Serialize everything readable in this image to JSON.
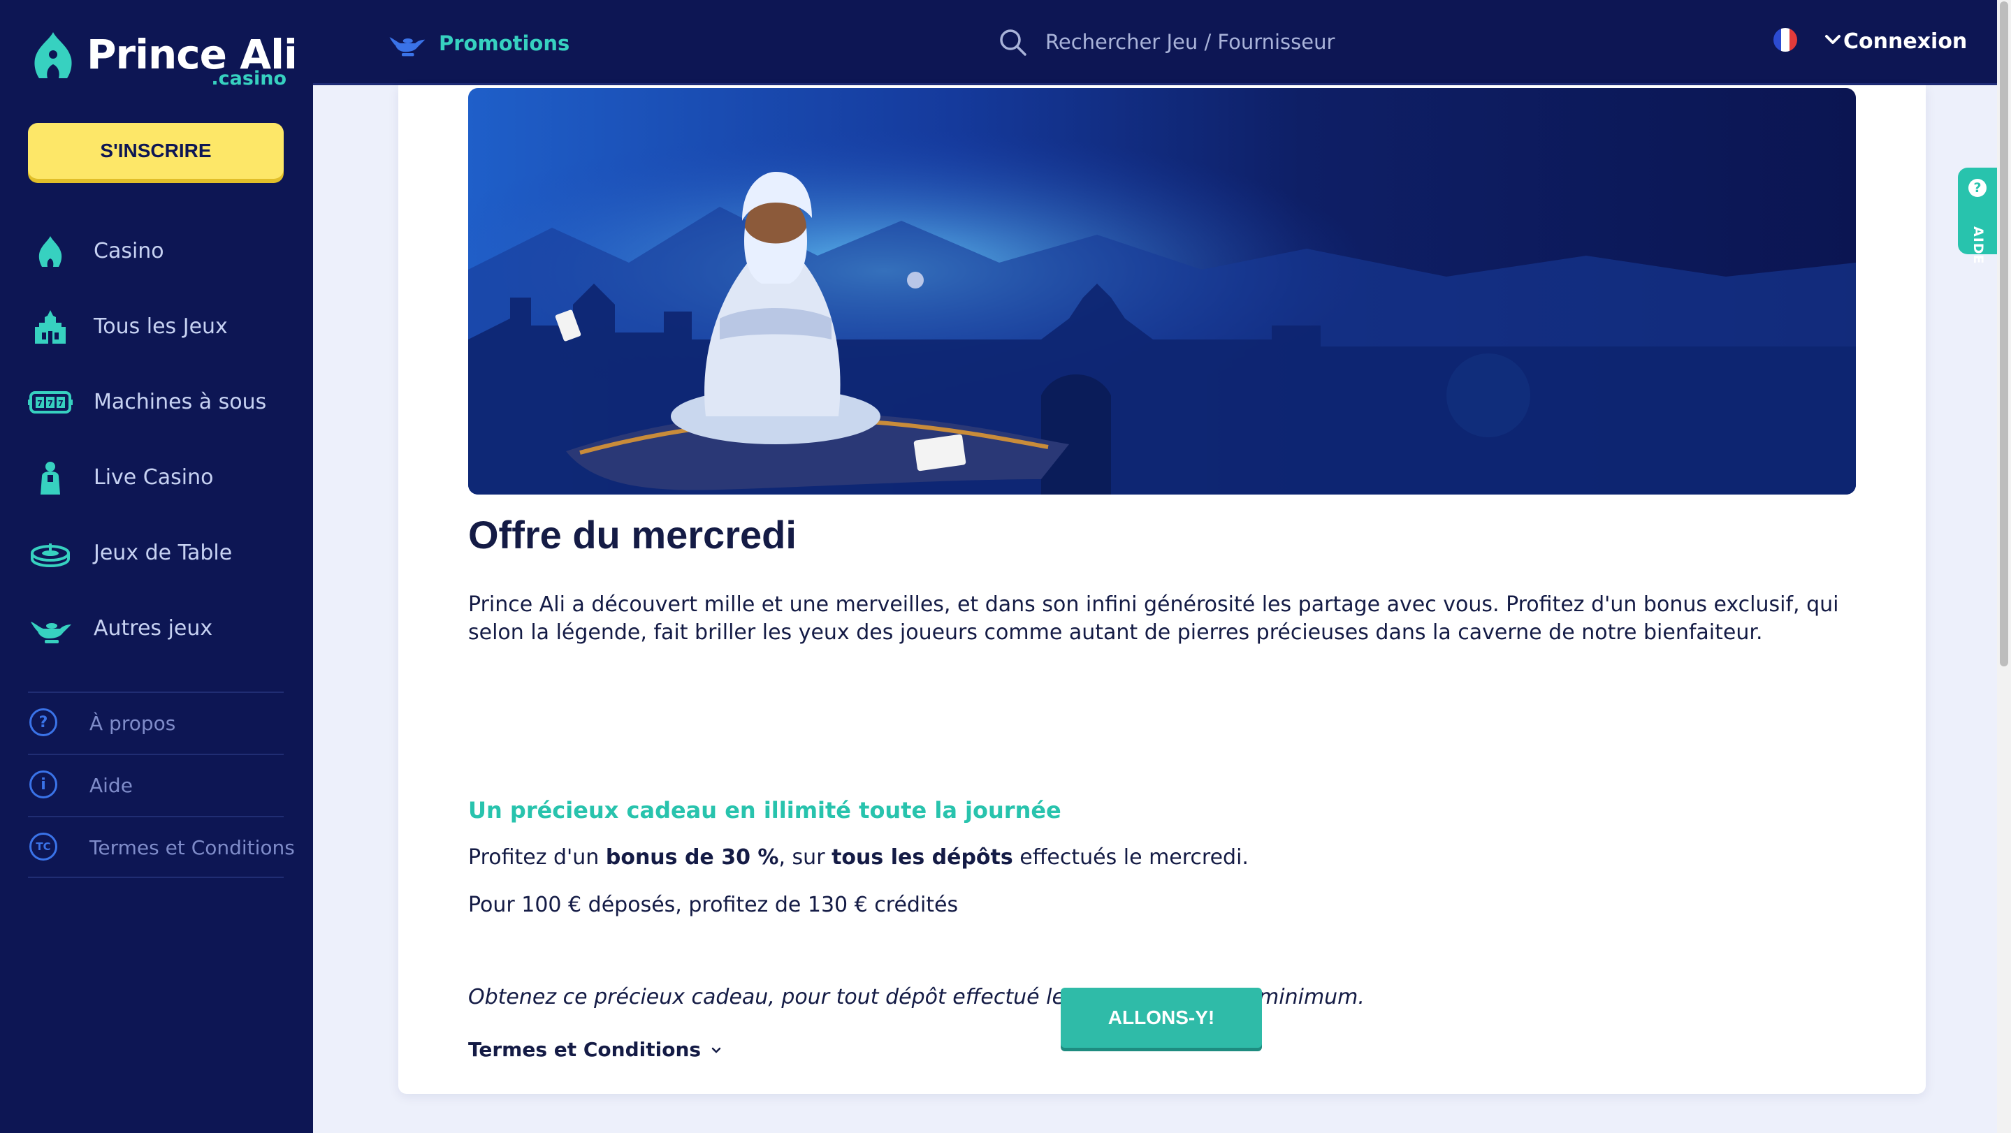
{
  "brand": {
    "name": "Prince Ali",
    "tld": ".casino",
    "colors": {
      "navy": "#0d1654",
      "teal": "#37d1c0",
      "yellow": "#fde768",
      "button": "#2fbba8"
    }
  },
  "sidebar": {
    "signup_label": "S'INSCRIRE",
    "nav": [
      {
        "label": "Casino",
        "icon": "palace-dome-icon"
      },
      {
        "label": "Tous les Jeux",
        "icon": "palace-building-icon"
      },
      {
        "label": "Machines à sous",
        "icon": "slot-machine-icon"
      },
      {
        "label": "Live Casino",
        "icon": "dealer-icon"
      },
      {
        "label": "Jeux de Table",
        "icon": "roulette-table-icon"
      },
      {
        "label": "Autres jeux",
        "icon": "magic-lamp-icon"
      }
    ],
    "info": [
      {
        "label": "À propos",
        "icon": "question-circle-icon",
        "glyph": "?"
      },
      {
        "label": "Aide",
        "icon": "info-circle-icon",
        "glyph": "i"
      },
      {
        "label": "Termes et Conditions",
        "icon": "tc-circle-icon",
        "glyph": "TC"
      }
    ]
  },
  "topbar": {
    "promotions_label": "Promotions",
    "search_placeholder": "Rechercher Jeu / Fournisseur",
    "language_icon": "france-flag-icon",
    "login_label": "Connexion"
  },
  "aide_tab": {
    "label": "AIDE",
    "glyph": "?"
  },
  "promo": {
    "title": "Offre du mercredi",
    "intro": "Prince Ali a découvert mille et une merveilles, et dans son infini générosité les partage avec vous. Profitez d'un bonus exclusif, qui selon la légende, fait briller les yeux des joueurs comme autant de pierres précieuses dans la caverne de notre bienfaiteur.",
    "subheading": "Un précieux cadeau en illimité toute la journée",
    "line1": {
      "part1": "Profitez d'un ",
      "bold1": "bonus de 30 %",
      "part2": ", sur ",
      "bold2": "tous les dépôts",
      "part3": " effectués le mercredi."
    },
    "line2": "Pour 100 € déposés, profitez de 130 € crédités",
    "note": "Obtenez ce précieux cadeau, pour tout dépôt effectué le mercredi de 20 € minimum.",
    "terms_label": "Termes et Conditions",
    "cta_label": "ALLONS-Y!"
  }
}
